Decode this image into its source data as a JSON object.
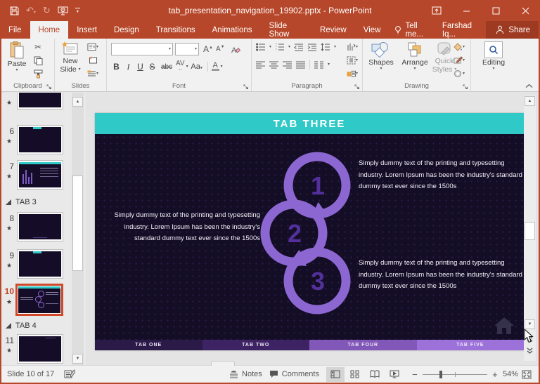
{
  "titlebar": {
    "title": "tab_presentation_navigation_19902.pptx - PowerPoint"
  },
  "ribbon": {
    "tabs": [
      {
        "label": "File"
      },
      {
        "label": "Home"
      },
      {
        "label": "Insert"
      },
      {
        "label": "Design"
      },
      {
        "label": "Transitions"
      },
      {
        "label": "Animations"
      },
      {
        "label": "Slide Show"
      },
      {
        "label": "Review"
      },
      {
        "label": "View"
      }
    ],
    "tell_me": "Tell me...",
    "account": "Farshad Iq...",
    "share": "Share",
    "groups": {
      "clipboard": {
        "label": "Clipboard",
        "paste": "Paste"
      },
      "slides": {
        "label": "Slides",
        "new_slide_line1": "New",
        "new_slide_line2": "Slide"
      },
      "font": {
        "label": "Font",
        "bold": "B",
        "italic": "I",
        "underline": "U",
        "strike": "S",
        "abc": "abc",
        "kerning": "AV",
        "change_case": "Aa",
        "font_color": "A",
        "grow": "A",
        "shrink": "A"
      },
      "paragraph": {
        "label": "Paragraph"
      },
      "drawing": {
        "label": "Drawing",
        "shapes": "Shapes",
        "arrange": "Arrange",
        "quick_styles_line1": "Quick",
        "quick_styles_line2": "Styles"
      },
      "editing": {
        "label": "Editing"
      }
    }
  },
  "slides_panel": {
    "slides": [
      {
        "num": "6"
      },
      {
        "num": "7"
      },
      {
        "num": "8"
      },
      {
        "num": "9"
      },
      {
        "num": "10"
      },
      {
        "num": "11"
      }
    ],
    "sections": [
      {
        "label": "TAB 3"
      },
      {
        "label": "TAB 4"
      }
    ],
    "selected_slide": "10"
  },
  "slide": {
    "title": "TAB THREE",
    "body_text": "Simply dummy text of the printing and typesetting industry. Lorem Ipsum has been the industry's standard dummy text ever since the 1500s",
    "steps": [
      {
        "num": "1"
      },
      {
        "num": "2"
      },
      {
        "num": "3"
      }
    ],
    "footer_tabs": [
      {
        "label": "TAB ONE"
      },
      {
        "label": "TAB TWO"
      },
      {
        "label": "TAB FOUR"
      },
      {
        "label": "TAB FIVE"
      }
    ],
    "colors": {
      "header_teal": "#2FC9C7",
      "background": "#140D26",
      "ring_purple": "#8C67D1",
      "number_purple": "#53309B",
      "tab_one": "#2B1A47",
      "tab_two": "#3D2363",
      "tab_four": "#8158B8",
      "tab_five": "#9C71D9",
      "selection_border": "#D0472A"
    }
  },
  "status_bar": {
    "slide_indicator": "Slide 10 of 17",
    "notes": "Notes",
    "comments": "Comments",
    "zoom_out": "−",
    "zoom_in": "+",
    "zoom_level": "54%"
  }
}
